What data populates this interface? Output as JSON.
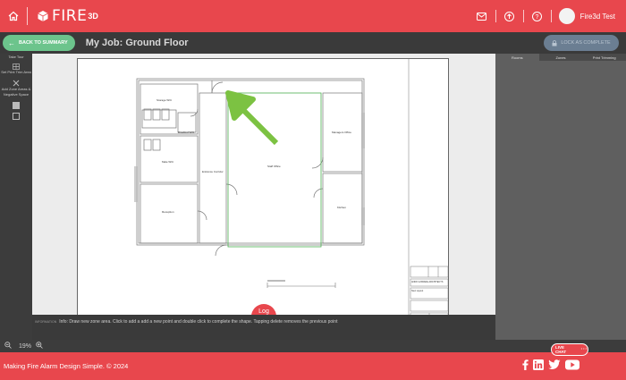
{
  "header": {
    "home_icon": "home-icon",
    "logo_text": "FIRE",
    "logo_sup": "3D",
    "icons": [
      "mail-icon",
      "upload-icon",
      "help-icon"
    ],
    "user_name": "Fire3d Test",
    "accent": "#e8474d"
  },
  "subheader": {
    "back_label": "BACK TO SUMMARY",
    "job_title": "My Job: Ground Floor",
    "lock_label": "LOCK AS COMPLETE"
  },
  "tools": {
    "t1": "Take Tour",
    "t2": "Set Print Trim Area",
    "t3a": "Add Zone Areas &",
    "t3b": "Negative Space"
  },
  "right_tabs": [
    "Rooms",
    "Zones",
    "Print Trimming"
  ],
  "canvas": {
    "log_label": "Log",
    "rooms": {
      "r1": "Storage W/C",
      "r2": "Disabled W/C",
      "r3": "Male W/C",
      "r4": "Reception",
      "r5": "Entrance Corridor",
      "r6": "Staff Office",
      "r7": "Managers Office",
      "r8": "Kitchen"
    },
    "titleblock": {
      "firm": "ANDO & BRADE ARCHITECTS",
      "project": "New Layout"
    }
  },
  "info": {
    "tag": "INFORMATION",
    "text": "Info: Draw new zone area. Click to add a add a new point and double click to complete the shape. Tapping delete removes the previous point"
  },
  "zoom": {
    "level": "19%",
    "out_icon": "zoom-out-icon",
    "in_icon": "zoom-in-icon"
  },
  "livechat": {
    "label": "LIVE CHAT",
    "dots": "···"
  },
  "footer": {
    "copyright": "Making Fire Alarm Design Simple. © 2024",
    "social": [
      "facebook-icon",
      "linkedin-icon",
      "twitter-icon",
      "youtube-icon"
    ]
  }
}
